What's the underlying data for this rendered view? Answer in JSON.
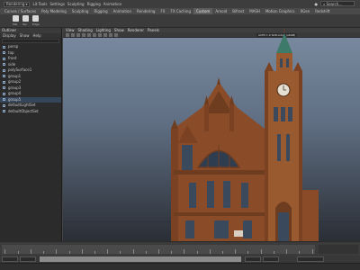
{
  "menubar": {
    "workspace": "Rendering",
    "menus": [
      "Lit Tools",
      "Settings",
      "Sculpting",
      "Rigging",
      "Animation"
    ],
    "search_placeholder": "Search..."
  },
  "shelf_tabs": [
    "Curves / Surfaces",
    "Poly Modeling",
    "Sculpting",
    "Rigging",
    "Animation",
    "Rendering",
    "FX",
    "FX Caching",
    "Custom",
    "Arnold",
    "Bifrost",
    "MASH",
    "Motion Graphics",
    "XGen",
    "Redshift"
  ],
  "shelf_active_tab": "Custom",
  "shelf_buttons": [
    "Mel",
    "Tex",
    "Edge"
  ],
  "outliner": {
    "title": "Outliner",
    "menu": [
      "Display",
      "Show",
      "Help"
    ],
    "items": [
      "persp",
      "top",
      "front",
      "side",
      "polySurface1",
      "group1",
      "group2",
      "group3",
      "group4",
      "group5",
      "defaultLightSet",
      "defaultObjectSet"
    ],
    "selected_index": 9
  },
  "viewport": {
    "menu": [
      "View",
      "Shading",
      "Lighting",
      "Show",
      "Renderer",
      "Panels"
    ],
    "camera": "ACES 1.0 SDR-video (sRGB)",
    "camera_label": "persp",
    "colors": {
      "sky_top": "#7b8ba1",
      "sky_bottom": "#2a2e35",
      "brick": "#9a5a30",
      "brick_dark": "#6e3d20",
      "window": "#3a4a5c",
      "spire": "#3e7a6a"
    }
  },
  "timeslider": {
    "ticks": [
      1,
      5,
      10,
      15,
      20,
      25,
      30,
      35,
      40,
      45,
      50,
      55,
      60,
      65,
      70,
      75,
      80,
      85,
      90,
      95,
      100,
      105,
      110,
      115,
      120
    ]
  },
  "rangeslider": {
    "start": "1",
    "end": "120"
  }
}
